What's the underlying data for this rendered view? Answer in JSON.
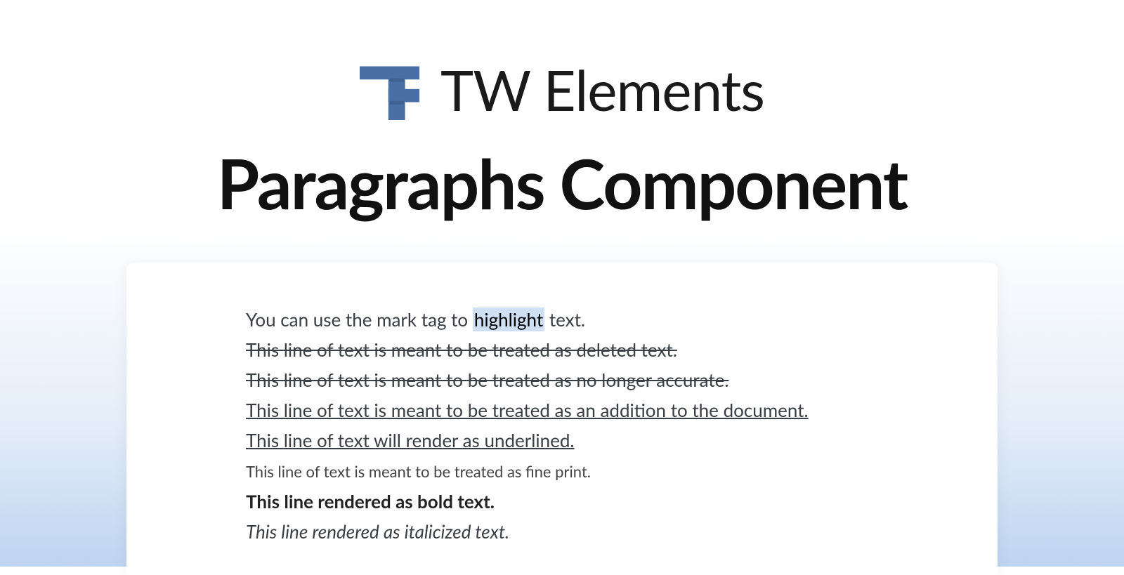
{
  "brand": {
    "name": "TW Elements",
    "logo_color": "#4a6fa5"
  },
  "title": "Paragraphs Component",
  "examples": {
    "mark": {
      "before": "You can use the mark tag to ",
      "highlight": "highlight",
      "after": " text."
    },
    "deleted": "This line of text is meant to be treated as deleted text.",
    "inaccurate": "This line of text is meant to be treated as no longer accurate.",
    "inserted": "This line of text is meant to be treated as an addition to the document.",
    "underlined": "This line of text will render as underlined.",
    "small": "This line of text is meant to be treated as fine print.",
    "bold": "This line rendered as bold text.",
    "italic": "This line rendered as italicized text."
  }
}
